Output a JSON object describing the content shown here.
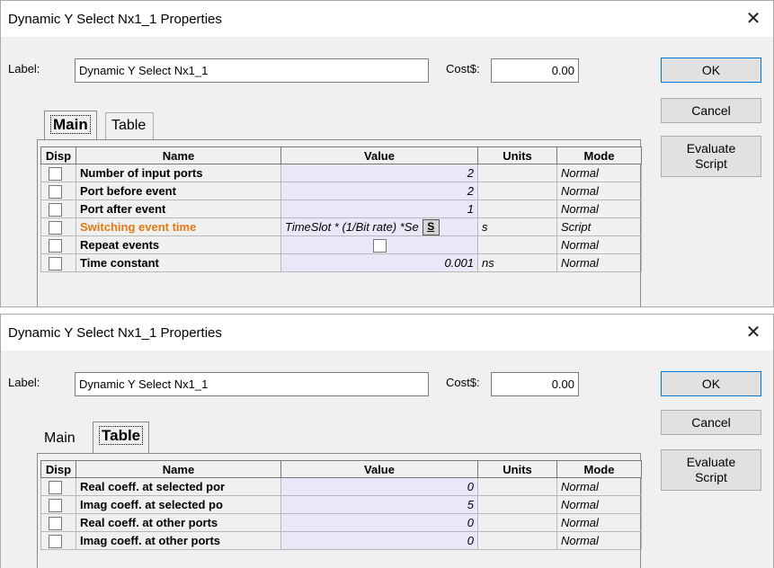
{
  "dialogs": [
    {
      "title": "Dynamic Y Select Nx1_1 Properties",
      "close_glyph": "✕",
      "label_caption": "Label:",
      "label_value": "Dynamic Y Select Nx1_1",
      "cost_caption": "Cost$:",
      "cost_value": "0.00",
      "buttons": {
        "ok": "OK",
        "cancel": "Cancel",
        "evaluate_line1": "Evaluate",
        "evaluate_line2": "Script"
      },
      "tabs": [
        {
          "label": "Main",
          "active": true
        },
        {
          "label": "Table",
          "active": false
        }
      ],
      "columns": [
        "Disp",
        "Name",
        "Value",
        "Units",
        "Mode"
      ],
      "rows": [
        {
          "name": "Number of input ports",
          "value": "2",
          "units": "",
          "mode": "Normal"
        },
        {
          "name": "Port before event",
          "value": "2",
          "units": "",
          "mode": "Normal"
        },
        {
          "name": "Port after event",
          "value": "1",
          "units": "",
          "mode": "Normal"
        },
        {
          "name": "Switching event time",
          "value": "TimeSlot * (1/Bit rate) *Se",
          "script_button": "S",
          "units": "s",
          "mode": "Script",
          "highlight": true
        },
        {
          "name": "Repeat events",
          "value": "",
          "units": "",
          "mode": "Normal",
          "value_checkbox": true
        },
        {
          "name": "Time constant",
          "value": "0.001",
          "units": "ns",
          "mode": "Normal"
        }
      ]
    },
    {
      "title": "Dynamic Y Select Nx1_1 Properties",
      "close_glyph": "✕",
      "label_caption": "Label:",
      "label_value": "Dynamic Y Select Nx1_1",
      "cost_caption": "Cost$:",
      "cost_value": "0.00",
      "buttons": {
        "ok": "OK",
        "cancel": "Cancel",
        "evaluate_line1": "Evaluate",
        "evaluate_line2": "Script"
      },
      "tabs": [
        {
          "label": "Main",
          "active": false
        },
        {
          "label": "Table",
          "active": true
        }
      ],
      "columns": [
        "Disp",
        "Name",
        "Value",
        "Units",
        "Mode"
      ],
      "rows": [
        {
          "name": "Real coeff. at selected por",
          "value": "0",
          "units": "",
          "mode": "Normal"
        },
        {
          "name": "Imag coeff. at selected po",
          "value": "5",
          "units": "",
          "mode": "Normal"
        },
        {
          "name": "Real coeff. at other ports",
          "value": "0",
          "units": "",
          "mode": "Normal"
        },
        {
          "name": "Imag coeff. at other ports",
          "value": "0",
          "units": "",
          "mode": "Normal"
        }
      ]
    }
  ],
  "colors": {
    "highlight_name": "#e07a14",
    "value_cell_bg": "#e8e8f8",
    "default_button_border": "#0078d7"
  }
}
